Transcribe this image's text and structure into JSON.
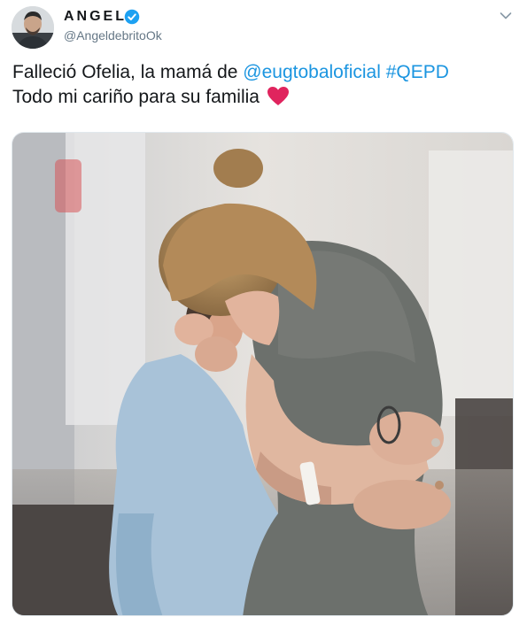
{
  "author": {
    "display_name": "ANGEL",
    "handle": "@AngeldebritoOk",
    "verified": true,
    "avatar_icon": "user-avatar-icon"
  },
  "tweet": {
    "line1_prefix": "Falleció Ofelia, la mamá de ",
    "mention": "@eugtobaloficial",
    "hashtag": "#QEPD",
    "line2": "Todo mi cariño para su familia",
    "emoji_icon": "red-heart-icon"
  },
  "media": {
    "icon": "photo-hug-icon"
  },
  "colors": {
    "link": "#1b95e0",
    "verified": "#1da1f2",
    "heart": "#e0245e",
    "secondary_text": "#657786"
  }
}
